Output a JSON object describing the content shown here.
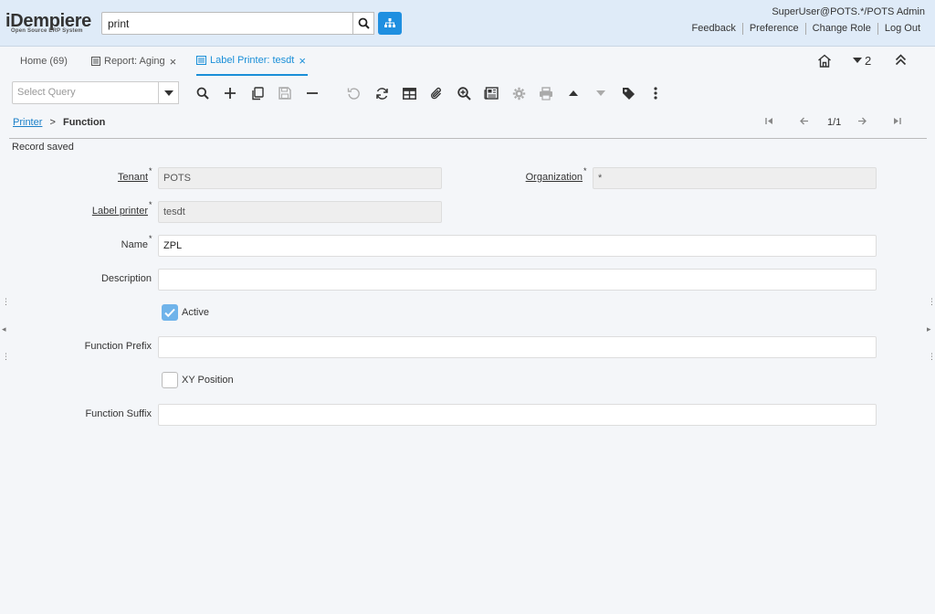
{
  "header": {
    "logo_text": "iDempiere",
    "logo_subtitle": "Open Source ERP System",
    "search_value": "print",
    "user": "SuperUser@POTS.*/POTS Admin",
    "links": [
      "Feedback",
      "Preference",
      "Change Role",
      "Log Out"
    ]
  },
  "tabs": [
    {
      "label": "Home (69)"
    },
    {
      "label": "Report: Aging"
    },
    {
      "label": "Label Printer: tesdt"
    }
  ],
  "tab_right": {
    "window_count": "2"
  },
  "toolbar": {
    "query_placeholder": "Select Query"
  },
  "breadcrumb": {
    "parent": "Printer",
    "separator": ">",
    "current": "Function"
  },
  "navigation": {
    "record_position": "1/1"
  },
  "status": "Record saved",
  "form": {
    "tenant": {
      "label": "Tenant",
      "value": "POTS"
    },
    "organization": {
      "label": "Organization",
      "value": "*"
    },
    "label_printer": {
      "label": "Label printer",
      "value": "tesdt"
    },
    "name": {
      "label": "Name",
      "value": "ZPL"
    },
    "description": {
      "label": "Description",
      "value": ""
    },
    "active": {
      "label": "Active",
      "checked": true
    },
    "function_prefix": {
      "label": "Function Prefix",
      "value": ""
    },
    "xy_position": {
      "label": "XY Position",
      "checked": false
    },
    "function_suffix": {
      "label": "Function Suffix",
      "value": ""
    }
  },
  "colors": {
    "accent": "#1a8fd8",
    "header_bg": "#dfebf8",
    "checkbox_on": "#6fb3ea"
  }
}
